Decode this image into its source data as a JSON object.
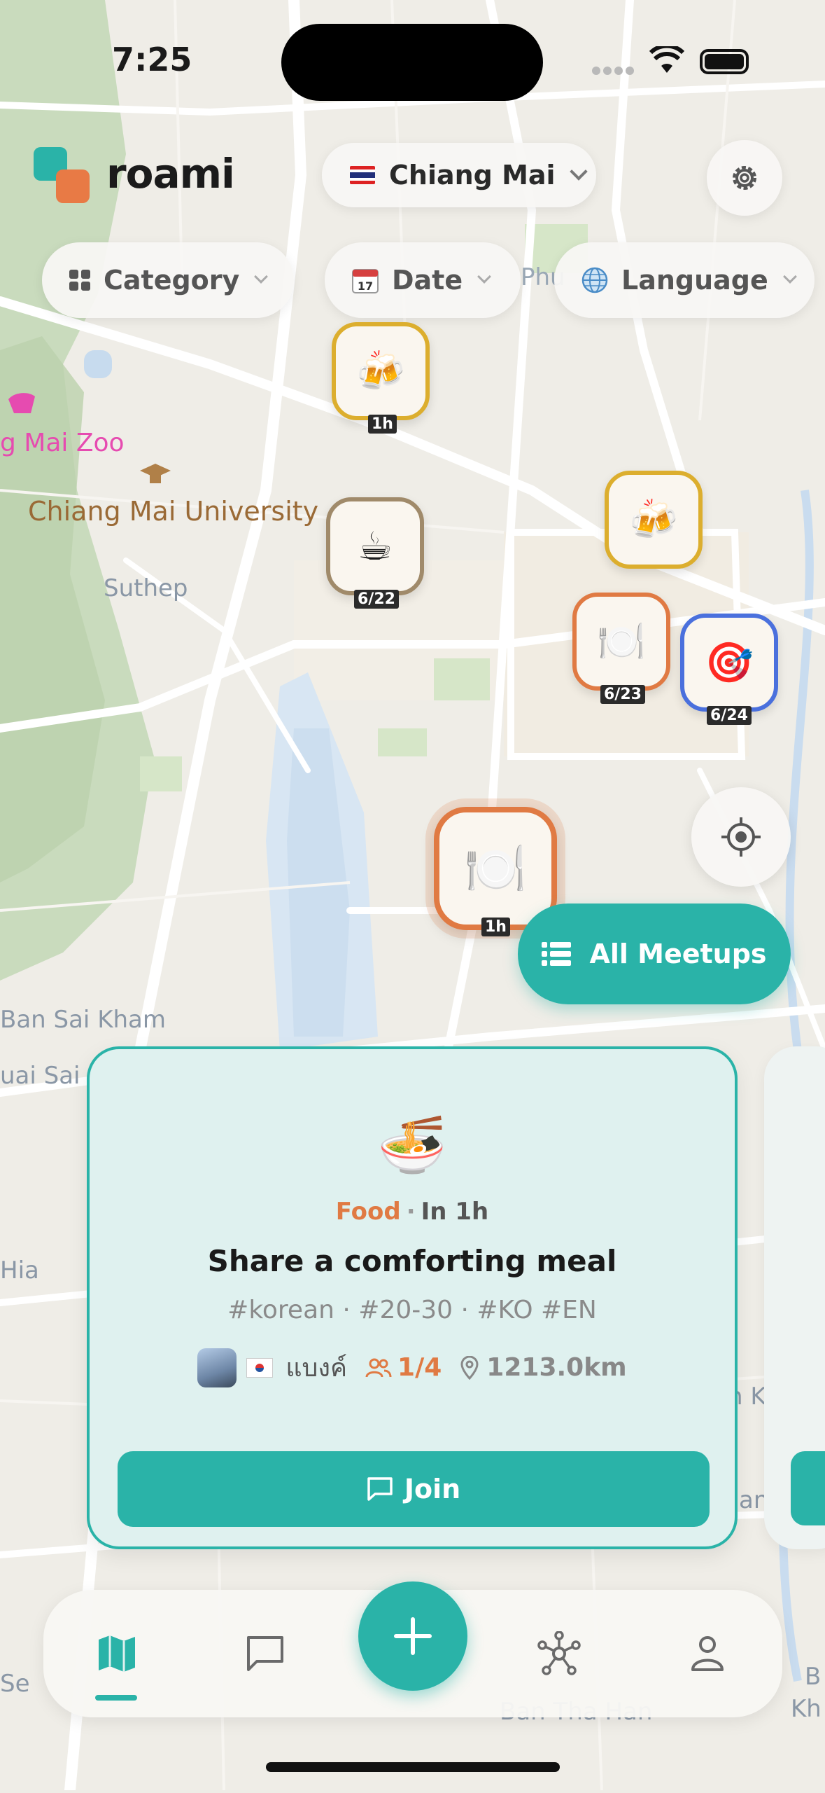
{
  "status_bar": {
    "time": "7:25"
  },
  "header": {
    "app_name": "roami",
    "city": "Chiang Mai"
  },
  "filters": {
    "category": "Category",
    "date": "Date",
    "language": "Language"
  },
  "map_labels": {
    "zoo": "g Mai Zoo",
    "university": "Chiang Mai University",
    "suthep": "Suthep",
    "phu": "Phu",
    "ban_sai_kham": "Ban Sai Kham",
    "uai_sai": "uai Sai",
    "hia": "Hia",
    "right_n": "n K",
    "right_an": "an",
    "left_se": "Se",
    "bottom_right": "B",
    "bottom_right2": "Kh",
    "bottom": "Ban Tha Han"
  },
  "markers": [
    {
      "icon": "beer",
      "label": "1h",
      "color": "#dcae2e"
    },
    {
      "icon": "coffee",
      "label": "6/22",
      "color": "#a08a6a"
    },
    {
      "icon": "beer",
      "label": "",
      "color": "#dcae2e"
    },
    {
      "icon": "plate",
      "label": "6/23",
      "color": "#e07a43"
    },
    {
      "icon": "target",
      "label": "6/24",
      "color": "#4a70dd"
    },
    {
      "icon": "plate",
      "label": "1h",
      "color": "#e07a43"
    }
  ],
  "actions": {
    "all_meetups": "All Meetups"
  },
  "card": {
    "emoji": "🍜",
    "category": "Food",
    "separator": "·",
    "when": "In 1h",
    "title": "Share a comforting meal",
    "tags": "#korean · #20-30 · #KO #EN",
    "host": "แบงค์",
    "attendees": "1/4",
    "distance": "1213.0km",
    "join_label": "Join"
  },
  "tabs": [
    {
      "icon": "map-icon",
      "active": true
    },
    {
      "icon": "chat-icon",
      "active": false
    },
    {
      "icon": "plus-icon",
      "active": false
    },
    {
      "icon": "network-icon",
      "active": false
    },
    {
      "icon": "profile-icon",
      "active": false
    }
  ],
  "colors": {
    "accent": "#2ab3a8",
    "food": "#e07a43",
    "card_bg": "#dff1ef"
  }
}
